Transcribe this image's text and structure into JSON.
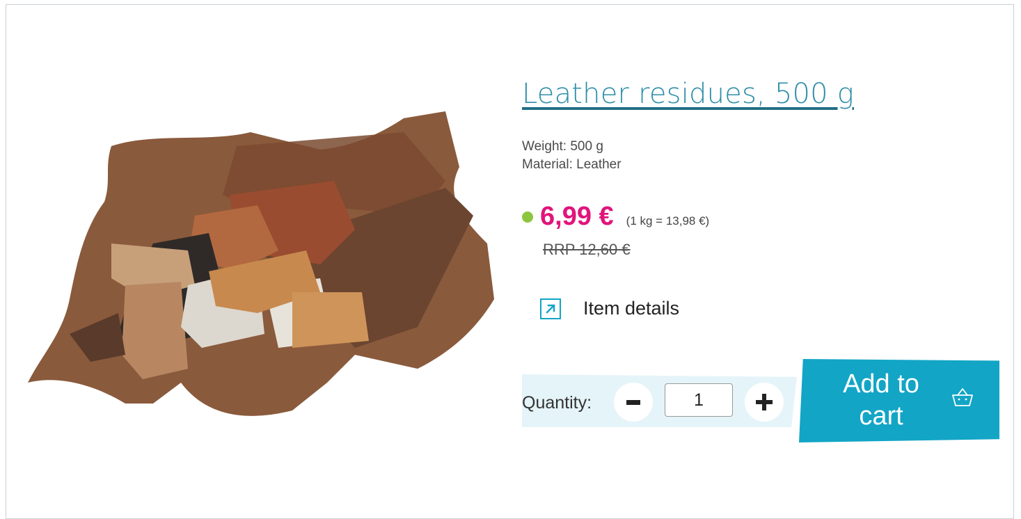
{
  "product": {
    "title": "Leather residues, 500 g",
    "attributes": [
      "Weight: 500 g",
      "Material: Leather"
    ],
    "price": "6,99 €",
    "unit_price": "(1 kg = 13,98 €)",
    "rrp": "RRP 12,60 €",
    "availability_color": "#8cc63f"
  },
  "details_link": {
    "label": "Item details",
    "icon": "external-arrow-icon"
  },
  "quantity": {
    "label": "Quantity:",
    "value": "1",
    "decrease_icon": "minus-icon",
    "increase_icon": "plus-icon"
  },
  "cart": {
    "label": "Add to cart",
    "icon": "basket-icon"
  },
  "colors": {
    "accent": "#12a5c6",
    "price": "#e0157b",
    "title": "#2e8ea8",
    "qty_background": "#e5f4f9"
  }
}
